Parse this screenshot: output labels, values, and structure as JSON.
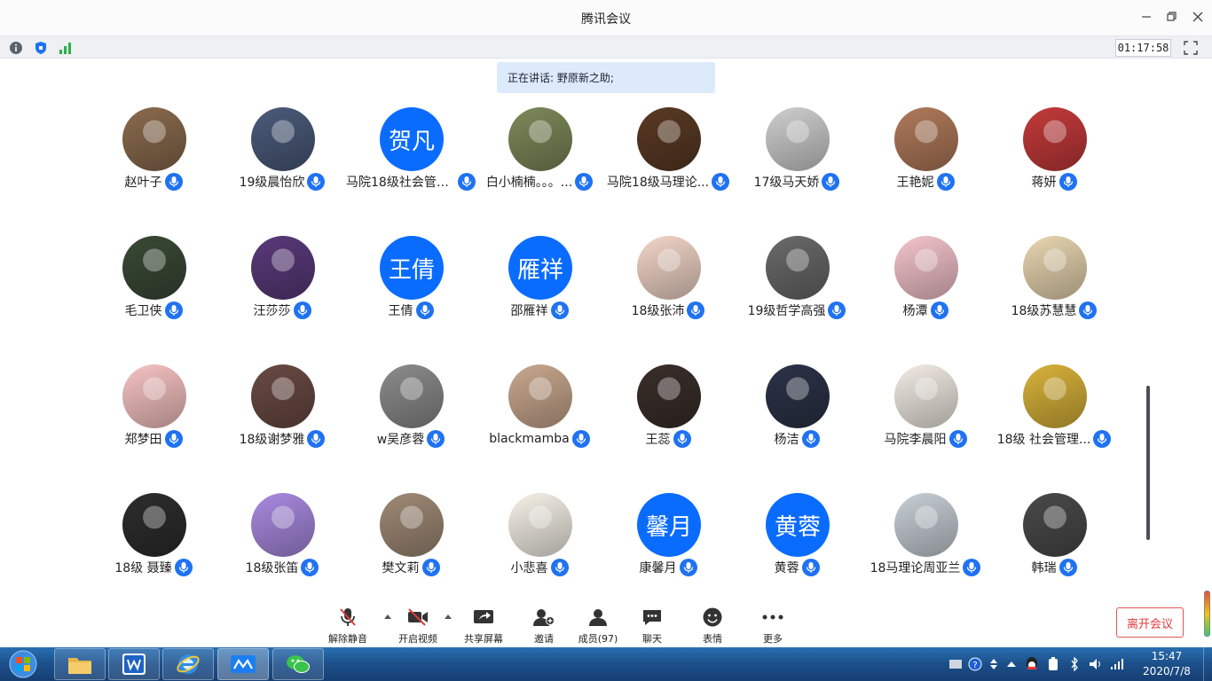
{
  "window": {
    "title": "腾讯会议"
  },
  "infobar": {
    "timer": "01:17:58",
    "icons": [
      "info-icon",
      "shield-icon",
      "signal-icon"
    ]
  },
  "speaking": {
    "text": "正在讲话: 野原新之助;"
  },
  "participants": [
    {
      "name": "赵叶子",
      "avatar": "photo",
      "color": "#8a6b4e"
    },
    {
      "name": "19级晨怡欣",
      "avatar": "photo",
      "color": "#4b5b7a"
    },
    {
      "name": "马院18级社会管理...",
      "avatar": "text",
      "text": "贺凡"
    },
    {
      "name": "白小楠楠。。。...",
      "avatar": "photo",
      "color": "#7d8a5a"
    },
    {
      "name": "马院18级马理论...",
      "avatar": "photo",
      "color": "#5a3a24"
    },
    {
      "name": "17级马天娇",
      "avatar": "photo",
      "color": "#cfcfcf"
    },
    {
      "name": "王艳妮",
      "avatar": "photo",
      "color": "#b07a5a"
    },
    {
      "name": "蒋妍",
      "avatar": "photo",
      "color": "#c43a3a"
    },
    {
      "name": "毛卫侠",
      "avatar": "photo",
      "color": "#3a4a36"
    },
    {
      "name": "汪莎莎",
      "avatar": "photo",
      "color": "#5a3a7a"
    },
    {
      "name": "王倩",
      "avatar": "text",
      "text": "王倩"
    },
    {
      "name": "邵雁祥",
      "avatar": "text",
      "text": "雁祥"
    },
    {
      "name": "18级张沛",
      "avatar": "photo",
      "color": "#f2d6c8"
    },
    {
      "name": "19级哲学高强",
      "avatar": "photo",
      "color": "#6a6a6a"
    },
    {
      "name": "杨潭",
      "avatar": "photo",
      "color": "#f4c4cc"
    },
    {
      "name": "18级苏慧慧",
      "avatar": "photo",
      "color": "#e9d6b0"
    },
    {
      "name": "郑梦田",
      "avatar": "photo",
      "color": "#f7c3c3"
    },
    {
      "name": "18级谢梦雅",
      "avatar": "photo",
      "color": "#6a4a44"
    },
    {
      "name": "w吴彦蓉",
      "avatar": "photo",
      "color": "#8c8c8c"
    },
    {
      "name": "blackmamba",
      "avatar": "photo",
      "color": "#c9a88e"
    },
    {
      "name": "王蕊",
      "avatar": "photo",
      "color": "#3a2e2a"
    },
    {
      "name": "杨洁",
      "avatar": "photo",
      "color": "#2c3348"
    },
    {
      "name": "马院李晨阳",
      "avatar": "photo",
      "color": "#f2ece4"
    },
    {
      "name": "18级 社会管理...",
      "avatar": "photo",
      "color": "#d8b23a"
    },
    {
      "name": "18级 聂臻",
      "avatar": "photo",
      "color": "#2d2d2d"
    },
    {
      "name": "18级张笛",
      "avatar": "photo",
      "color": "#a98ae0"
    },
    {
      "name": "樊文莉",
      "avatar": "photo",
      "color": "#a08a76"
    },
    {
      "name": "小悲喜",
      "avatar": "photo",
      "color": "#f6f2e8"
    },
    {
      "name": "康馨月",
      "avatar": "text",
      "text": "馨月"
    },
    {
      "name": "黄蓉",
      "avatar": "text",
      "text": "黄蓉"
    },
    {
      "name": "18马理论周亚兰",
      "avatar": "photo",
      "color": "#c8cfd6"
    },
    {
      "name": "韩瑞",
      "avatar": "photo",
      "color": "#4a4a4a"
    }
  ],
  "controls": {
    "unmute": "解除静音",
    "start_video": "开启视频",
    "share_screen": "共享屏幕",
    "invite": "邀请",
    "members": "成员(97)",
    "chat": "聊天",
    "emoji": "表情",
    "more": "更多",
    "leave": "离开会议"
  },
  "taskbar": {
    "apps": [
      "explorer-icon",
      "wps-icon",
      "ie-icon",
      "tencent-meeting-icon",
      "wechat-icon"
    ],
    "time": "15:47",
    "date": "2020/7/8"
  },
  "colors": {
    "accent": "#1f72f2",
    "danger": "#e03b3b"
  }
}
